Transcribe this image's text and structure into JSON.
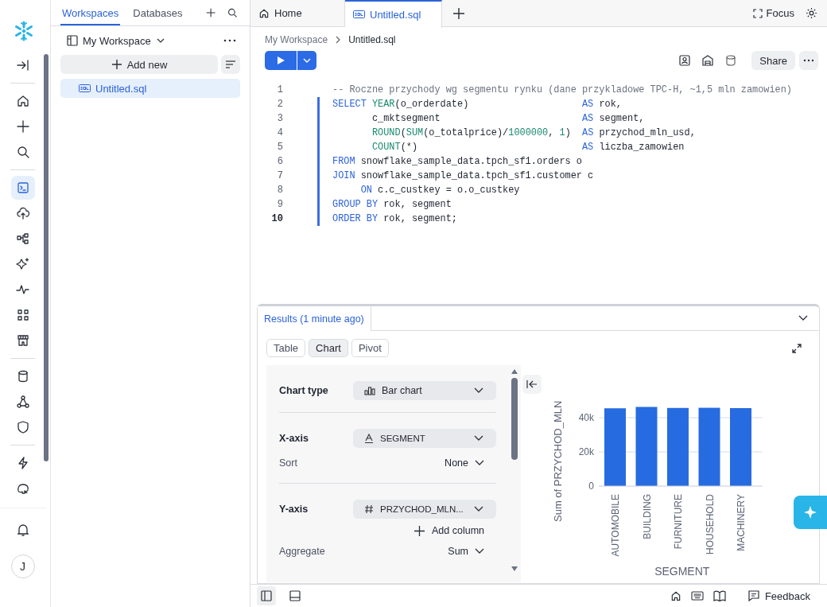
{
  "rail": {
    "sections": [
      {
        "items": [
          {
            "kind": "collapse",
            "selected": false
          }
        ]
      },
      {
        "items": [
          {
            "kind": "home",
            "selected": false
          },
          {
            "kind": "create",
            "selected": false
          },
          {
            "kind": "search",
            "selected": false
          }
        ]
      },
      {
        "items": [
          {
            "kind": "terminal",
            "selected": true
          },
          {
            "kind": "upload",
            "selected": false
          },
          {
            "kind": "flow",
            "selected": false
          },
          {
            "kind": "sparkle",
            "selected": false
          },
          {
            "kind": "pulse",
            "selected": false
          },
          {
            "kind": "grid",
            "selected": false
          },
          {
            "kind": "store",
            "selected": false
          }
        ]
      },
      {
        "items": [
          {
            "kind": "database",
            "selected": false
          },
          {
            "kind": "nodes",
            "selected": false
          },
          {
            "kind": "shield",
            "selected": false
          }
        ]
      },
      {
        "items": [
          {
            "kind": "bolt",
            "selected": false
          },
          {
            "kind": "elephant",
            "selected": false
          }
        ]
      }
    ],
    "avatar": "J"
  },
  "sidebar": {
    "tabs": [
      {
        "label": "Workspaces",
        "selected": true
      },
      {
        "label": "Databases",
        "selected": false
      }
    ],
    "workspace": "My Workspace",
    "add_button": "Add new",
    "files": [
      {
        "name": "Untitled.sql",
        "selected": true
      }
    ]
  },
  "tabs": [
    {
      "label": "Home",
      "kind": "home",
      "selected": false
    },
    {
      "label": "Untitled.sql",
      "kind": "sql",
      "selected": true
    }
  ],
  "focus_button": "Focus",
  "breadcrumb": [
    "My Workspace",
    "Untitled.sql"
  ],
  "share_button": "Share",
  "editor": {
    "lines": [
      {
        "number": "1",
        "current": false,
        "in_statement": false,
        "tokens": [
          {
            "kind": "comment",
            "text": "-- Roczne przychody wg segmentu rynku (dane przykladowe TPC-H, ~1,5 mln zamowien)"
          }
        ]
      },
      {
        "number": "2",
        "current": false,
        "in_statement": true,
        "tokens": [
          {
            "kind": "keyword",
            "text": "SELECT "
          },
          {
            "kind": "function",
            "text": "YEAR"
          },
          {
            "kind": "plain",
            "text": "(o_orderdate)                    "
          },
          {
            "kind": "keyword",
            "text": "AS"
          },
          {
            "kind": "plain",
            "text": " rok,"
          }
        ]
      },
      {
        "number": "3",
        "current": false,
        "in_statement": true,
        "tokens": [
          {
            "kind": "plain",
            "text": "       c_mktsegment                         "
          },
          {
            "kind": "keyword",
            "text": "AS"
          },
          {
            "kind": "plain",
            "text": " segment,"
          }
        ]
      },
      {
        "number": "4",
        "current": false,
        "in_statement": true,
        "tokens": [
          {
            "kind": "function",
            "text": "       ROUND"
          },
          {
            "kind": "plain",
            "text": "("
          },
          {
            "kind": "function",
            "text": "SUM"
          },
          {
            "kind": "plain",
            "text": "(o_totalprice)/"
          },
          {
            "kind": "number",
            "text": "1000000"
          },
          {
            "kind": "plain",
            "text": ", "
          },
          {
            "kind": "number",
            "text": "1"
          },
          {
            "kind": "plain",
            "text": ")  "
          },
          {
            "kind": "keyword",
            "text": "AS"
          },
          {
            "kind": "plain",
            "text": " przychod_mln_usd,"
          }
        ]
      },
      {
        "number": "5",
        "current": false,
        "in_statement": true,
        "tokens": [
          {
            "kind": "function",
            "text": "       COUNT"
          },
          {
            "kind": "plain",
            "text": "(*)                             "
          },
          {
            "kind": "keyword",
            "text": "AS"
          },
          {
            "kind": "plain",
            "text": " liczba_zamowien"
          }
        ]
      },
      {
        "number": "6",
        "current": false,
        "in_statement": true,
        "tokens": [
          {
            "kind": "keyword",
            "text": "FROM"
          },
          {
            "kind": "plain",
            "text": " snowflake_sample_data.tpch_sf1.orders o"
          }
        ]
      },
      {
        "number": "7",
        "current": false,
        "in_statement": true,
        "tokens": [
          {
            "kind": "keyword",
            "text": "JOIN"
          },
          {
            "kind": "plain",
            "text": " snowflake_sample_data.tpch_sf1.customer c"
          }
        ]
      },
      {
        "number": "8",
        "current": false,
        "in_statement": true,
        "tokens": [
          {
            "kind": "keyword",
            "text": "     ON"
          },
          {
            "kind": "plain",
            "text": " c.c_custkey = o.o_custkey"
          }
        ]
      },
      {
        "number": "9",
        "current": false,
        "in_statement": true,
        "tokens": [
          {
            "kind": "keyword",
            "text": "GROUP BY"
          },
          {
            "kind": "plain",
            "text": " rok, segment"
          }
        ]
      },
      {
        "number": "10",
        "current": true,
        "in_statement": true,
        "tokens": [
          {
            "kind": "keyword",
            "text": "ORDER BY"
          },
          {
            "kind": "plain",
            "text": " rok, segment;"
          }
        ]
      }
    ]
  },
  "results": {
    "title": "Results (1 minute ago)",
    "views": [
      {
        "label": "Table",
        "selected": false
      },
      {
        "label": "Chart",
        "selected": true
      },
      {
        "label": "Pivot",
        "selected": false
      }
    ],
    "config": {
      "chart_type": {
        "label": "Chart type",
        "value": "Bar chart"
      },
      "x_axis": {
        "label": "X-axis",
        "value": "SEGMENT",
        "sort_label": "Sort",
        "sort_value": "None"
      },
      "y_axis": {
        "label": "Y-axis",
        "value": "PRZYCHOD_MLN...",
        "add_column": "Add column",
        "aggregate_label": "Aggregate",
        "aggregate_value": "Sum"
      }
    },
    "chart_data": {
      "type": "bar",
      "xlabel": "SEGMENT",
      "ylabel": "Sum of PRZYCHOD_MLN",
      "categories": [
        "AUTOMOBILE",
        "BUILDING",
        "FURNITURE",
        "HOUSEHOLD",
        "MACHINERY"
      ],
      "series": [
        {
          "color": "#276be0",
          "values": [
            45500,
            46300,
            45700,
            45800,
            45600
          ]
        }
      ],
      "ylim": [
        0,
        46300
      ],
      "yticks": [
        {
          "value": 0,
          "label": "0"
        },
        {
          "value": 20000,
          "label": "20k"
        },
        {
          "value": 40000,
          "label": "40k"
        }
      ]
    }
  },
  "status_bar": {
    "feedback": "Feedback"
  }
}
